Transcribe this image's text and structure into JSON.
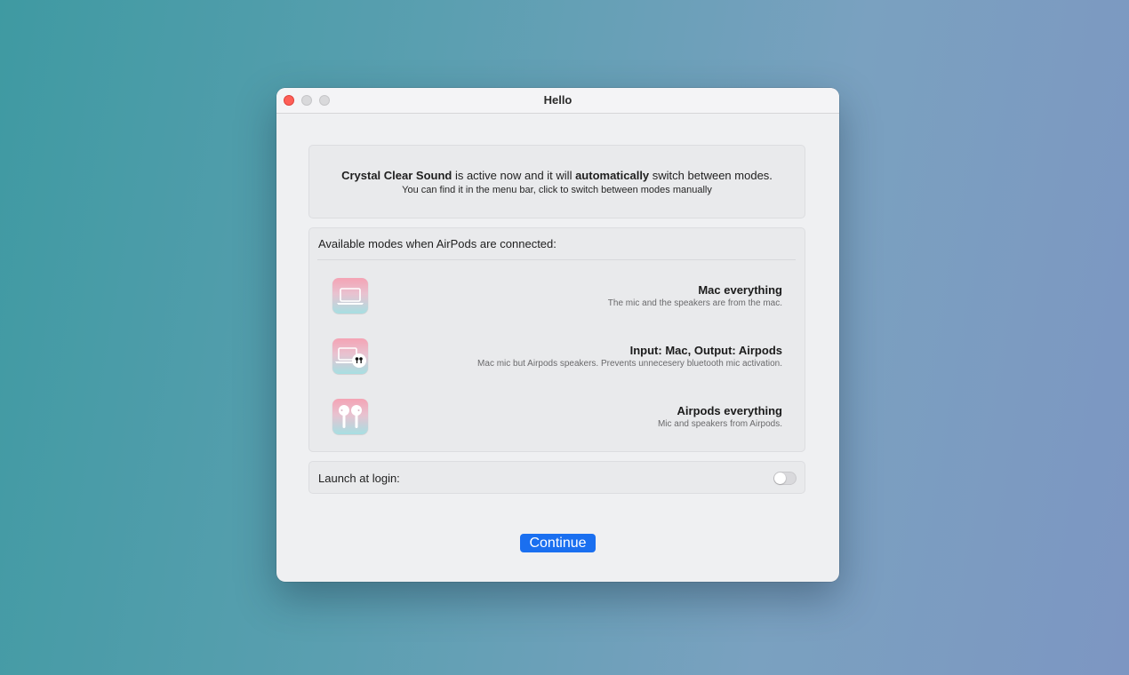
{
  "window": {
    "title": "Hello"
  },
  "intro": {
    "app_name": "Crystal Clear Sound",
    "text_middle": " is active now and it will ",
    "emphasis": "automatically",
    "text_end": " switch between modes.",
    "subtitle": "You can find it in the menu bar, click to switch between modes manually"
  },
  "modes": {
    "header": "Available modes when AirPods are connected:",
    "items": [
      {
        "icon": "laptop-icon",
        "title": "Mac everything",
        "description": "The mic and the speakers are from the mac."
      },
      {
        "icon": "laptop-airpods-icon",
        "title": "Input: Mac, Output: Airpods",
        "description": "Mac mic but Airpods speakers. Prevents unnecesery bluetooth mic activation."
      },
      {
        "icon": "airpods-icon",
        "title": "Airpods everything",
        "description": "Mic and speakers from Airpods."
      }
    ]
  },
  "launch": {
    "label": "Launch at login:",
    "enabled": false
  },
  "continue_label": "Continue",
  "colors": {
    "accent": "#1a6ff0",
    "close": "#fe5f57"
  }
}
